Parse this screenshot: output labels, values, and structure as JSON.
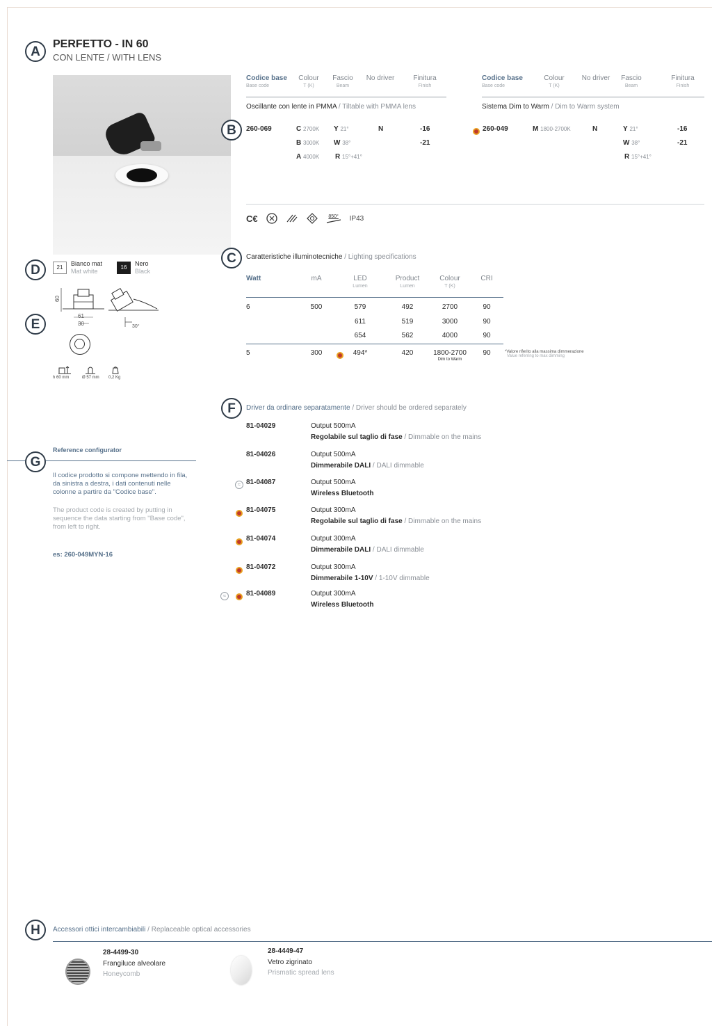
{
  "header": {
    "letter": "A",
    "title": "PERFETTO - IN 60",
    "subtitle": "CON LENTE / WITH LENS"
  },
  "colA": {
    "h1": {
      "title": "Codice base",
      "sub": "Base code"
    },
    "h2": {
      "title": "Colour",
      "sub": "T (K)"
    },
    "h3": {
      "title": "Fascio",
      "sub": "Beam"
    },
    "h4": {
      "title": "No driver",
      "sub": ""
    },
    "h5": {
      "title": "Finitura",
      "sub": "Finish"
    },
    "desc_bold": "Oscillante con lente in PMMA",
    "desc_light": "/ Tiltable with PMMA lens",
    "code": "260-069",
    "colours": [
      {
        "l": "C",
        "v": "2700K"
      },
      {
        "l": "B",
        "v": "3000K"
      },
      {
        "l": "A",
        "v": "4000K"
      }
    ],
    "beams": [
      {
        "l": "Y",
        "v": "21°"
      },
      {
        "l": "W",
        "v": "38°"
      },
      {
        "l": "R",
        "v": "15°+41°"
      }
    ],
    "driver": "N",
    "finishes": [
      "-16",
      "-21"
    ]
  },
  "colB": {
    "h1": {
      "title": "Codice base",
      "sub": "Base code"
    },
    "h2": {
      "title": "Colour",
      "sub": "T (K)"
    },
    "h3": {
      "title": "No driver",
      "sub": ""
    },
    "h4": {
      "title": "Fascio",
      "sub": "Beam"
    },
    "h5": {
      "title": "Finitura",
      "sub": "Finish"
    },
    "desc_bold": "Sistema Dim to Warm",
    "desc_light": "/ Dim to Warm system",
    "code": "260-049",
    "colour": {
      "l": "M",
      "v": "1800-2700K"
    },
    "driver": "N",
    "beams": [
      {
        "l": "Y",
        "v": "21°"
      },
      {
        "l": "W",
        "v": "38°"
      },
      {
        "l": "R",
        "v": "15°+41°"
      }
    ],
    "finishes": [
      "-16",
      "-21"
    ]
  },
  "markB": "B",
  "certs": {
    "ip": "IP43",
    "temp": "850°"
  },
  "finishSwatches": {
    "letter": "D",
    "items": [
      {
        "code": "21",
        "it": "Bianco mat",
        "en": "Mat white"
      },
      {
        "code": "16",
        "it": "Nero",
        "en": "Black"
      }
    ]
  },
  "dims": {
    "letter": "E",
    "h": "60",
    "w1": "61",
    "w2": "30",
    "tilt": "30°",
    "icon1": "h 60 mm",
    "icon2": "Ø 57 mm",
    "icon3": "0,2 Kg"
  },
  "lighting": {
    "letter": "C",
    "title_bold": "Caratteristiche illuminotecniche",
    "title_light": "/ Lighting specifications",
    "headers": [
      {
        "t": "Watt",
        "s": ""
      },
      {
        "t": "mA",
        "s": ""
      },
      {
        "t": "LED",
        "s": "Lumen"
      },
      {
        "t": "Product",
        "s": "Lumen"
      },
      {
        "t": "Colour",
        "s": "T (K)"
      },
      {
        "t": "CRI",
        "s": ""
      }
    ],
    "rows": [
      {
        "watt": "6",
        "ma": "500",
        "led": "579",
        "prod": "492",
        "colour": "2700",
        "cri": "90"
      },
      {
        "watt": "",
        "ma": "",
        "led": "611",
        "prod": "519",
        "colour": "3000",
        "cri": "90"
      },
      {
        "watt": "",
        "ma": "",
        "led": "654",
        "prod": "562",
        "colour": "4000",
        "cri": "90"
      }
    ],
    "dtw": {
      "watt": "5",
      "ma": "300",
      "led": "494*",
      "prod": "420",
      "colour": "1800-2700",
      "colour_sub": "Dim to Warm",
      "cri": "90"
    },
    "note1": "*Valore riferito alla massima dimmerazione",
    "note2": "Value referring to max dimming"
  },
  "drivers": {
    "letter": "F",
    "title_bold": "Driver da ordinare separatamente",
    "title_light": "/ Driver should be ordered separately",
    "items": [
      {
        "code": "81-04029",
        "l1": "Output 500mA",
        "l2b": "Regolabile sul taglio di fase",
        "l2l": "/ Dimmable on the mains"
      },
      {
        "code": "81-04026",
        "l1": "Output 500mA",
        "l2b": "Dimmerabile DALI",
        "l2l": "/ DALI dimmable"
      },
      {
        "code": "81-04087",
        "l1": "Output 500mA",
        "l2b": "Wireless Bluetooth",
        "l2l": ""
      },
      {
        "code": "81-04075",
        "l1": "Output 300mA",
        "l2b": "Regolabile sul taglio di fase",
        "l2l": "/ Dimmable on the mains"
      },
      {
        "code": "81-04074",
        "l1": "Output 300mA",
        "l2b": "Dimmerabile DALI",
        "l2l": "/ DALI dimmable"
      },
      {
        "code": "81-04072",
        "l1": "Output 300mA",
        "l2b": "Dimmerabile 1-10V",
        "l2l": "/ 1-10V dimmable"
      },
      {
        "code": "81-04089",
        "l1": "Output 300mA",
        "l2b": "Wireless Bluetooth",
        "l2l": ""
      }
    ]
  },
  "configurator": {
    "letter": "G",
    "title": "Reference configurator",
    "it": "Il codice prodotto si compone mettendo in fila, da sinistra a destra, i dati contenuti nelle colonne a partire da \"Codice base\".",
    "en": "The product code is created by putting in sequence the data starting from \"Base code\", from left to right.",
    "example": "es: 260-049MYN-16"
  },
  "accessories": {
    "letter": "H",
    "title_bold": "Accessori ottici intercambiabili",
    "title_light": "/ Replaceable optical accessories",
    "items": [
      {
        "code": "28-4499-30",
        "it": "Frangiluce alveolare",
        "en": "Honeycomb"
      },
      {
        "code": "28-4449-47",
        "it": "Vetro zigrinato",
        "en": "Prismatic spread lens"
      }
    ]
  }
}
